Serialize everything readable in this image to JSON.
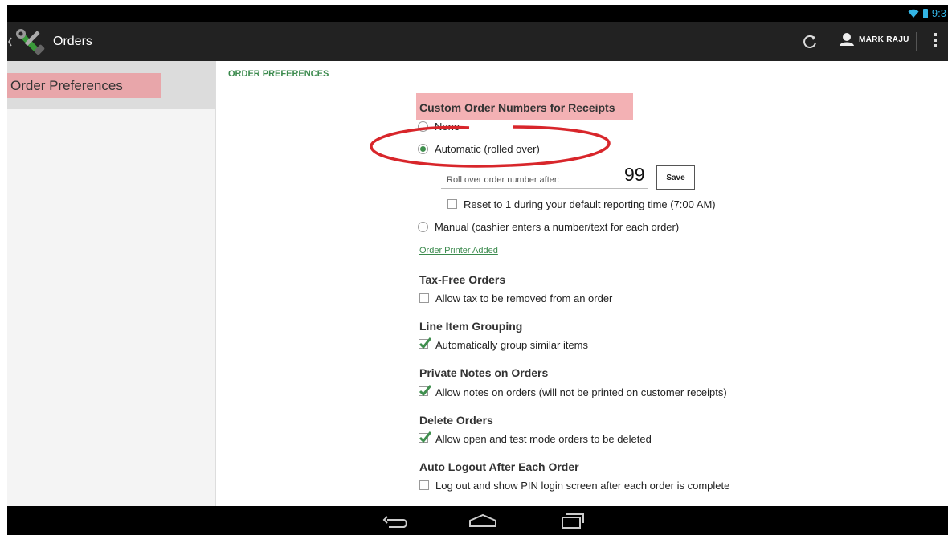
{
  "status_bar": {
    "time": "9:3"
  },
  "action_bar": {
    "title": "Orders",
    "user_name": "MARK RAJU"
  },
  "sidebar": {
    "items": [
      {
        "label": "Order Preferences"
      }
    ]
  },
  "main": {
    "section_title": "ORDER PREFERENCES",
    "custom_order": {
      "heading": "Custom Order Numbers for Receipts",
      "option_none": "None",
      "option_automatic": "Automatic (rolled over)",
      "rollover_label": "Roll over order number after:",
      "rollover_value": "99",
      "save_label": "Save",
      "reset_label": "Reset to 1 during your default reporting time (7:00 AM)",
      "option_manual": "Manual (cashier enters a number/text for each order)",
      "printer_link": "Order Printer Added"
    },
    "tax_free": {
      "heading": "Tax-Free Orders",
      "label": "Allow tax to be removed from an order",
      "checked": false
    },
    "line_item": {
      "heading": "Line Item Grouping",
      "label": "Automatically group similar items",
      "checked": true
    },
    "private_notes": {
      "heading": "Private Notes on Orders",
      "label": "Allow notes on orders (will not be printed on customer receipts)",
      "checked": true
    },
    "delete_orders": {
      "heading": "Delete Orders",
      "label": "Allow open and test mode orders to be deleted",
      "checked": true
    },
    "auto_logout": {
      "heading": "Auto Logout After Each Order",
      "label": "Log out and show PIN login screen after each order is complete",
      "checked": false
    }
  },
  "colors": {
    "accent_green": "#3b8a4d",
    "highlight_pink": "#f3b1b4",
    "annotation_red": "#d8262b"
  }
}
